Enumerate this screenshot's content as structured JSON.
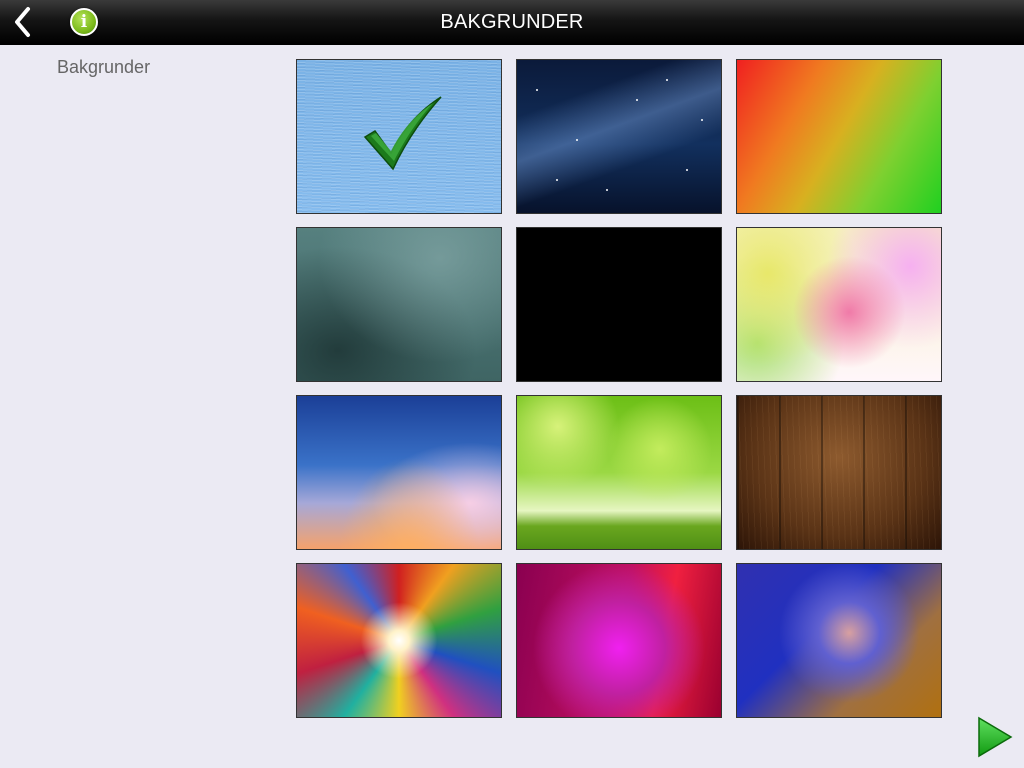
{
  "header": {
    "title": "BAKGRUNDER",
    "back_icon": "chevron-left-icon",
    "info_icon": "info-icon",
    "info_glyph": "i",
    "info_color": "#7dbb1c"
  },
  "sidebar": {
    "label": "Bakgrunder"
  },
  "backgrounds": [
    {
      "name": "blue-paper",
      "selected": true
    },
    {
      "name": "starry-night",
      "selected": false
    },
    {
      "name": "orange-green-mosaic",
      "selected": false
    },
    {
      "name": "teal-texture",
      "selected": false
    },
    {
      "name": "black",
      "selected": false
    },
    {
      "name": "pastel-blur",
      "selected": false
    },
    {
      "name": "sunset-sky",
      "selected": false
    },
    {
      "name": "green-bokeh-grass",
      "selected": false
    },
    {
      "name": "wood-planks",
      "selected": false
    },
    {
      "name": "color-burst",
      "selected": false
    },
    {
      "name": "magenta-cells",
      "selected": false
    },
    {
      "name": "blue-swirl",
      "selected": false
    }
  ],
  "selection_icon": "checkmark-icon",
  "footer": {
    "next_icon": "play-next-icon",
    "next_color": "#1fb81f"
  }
}
